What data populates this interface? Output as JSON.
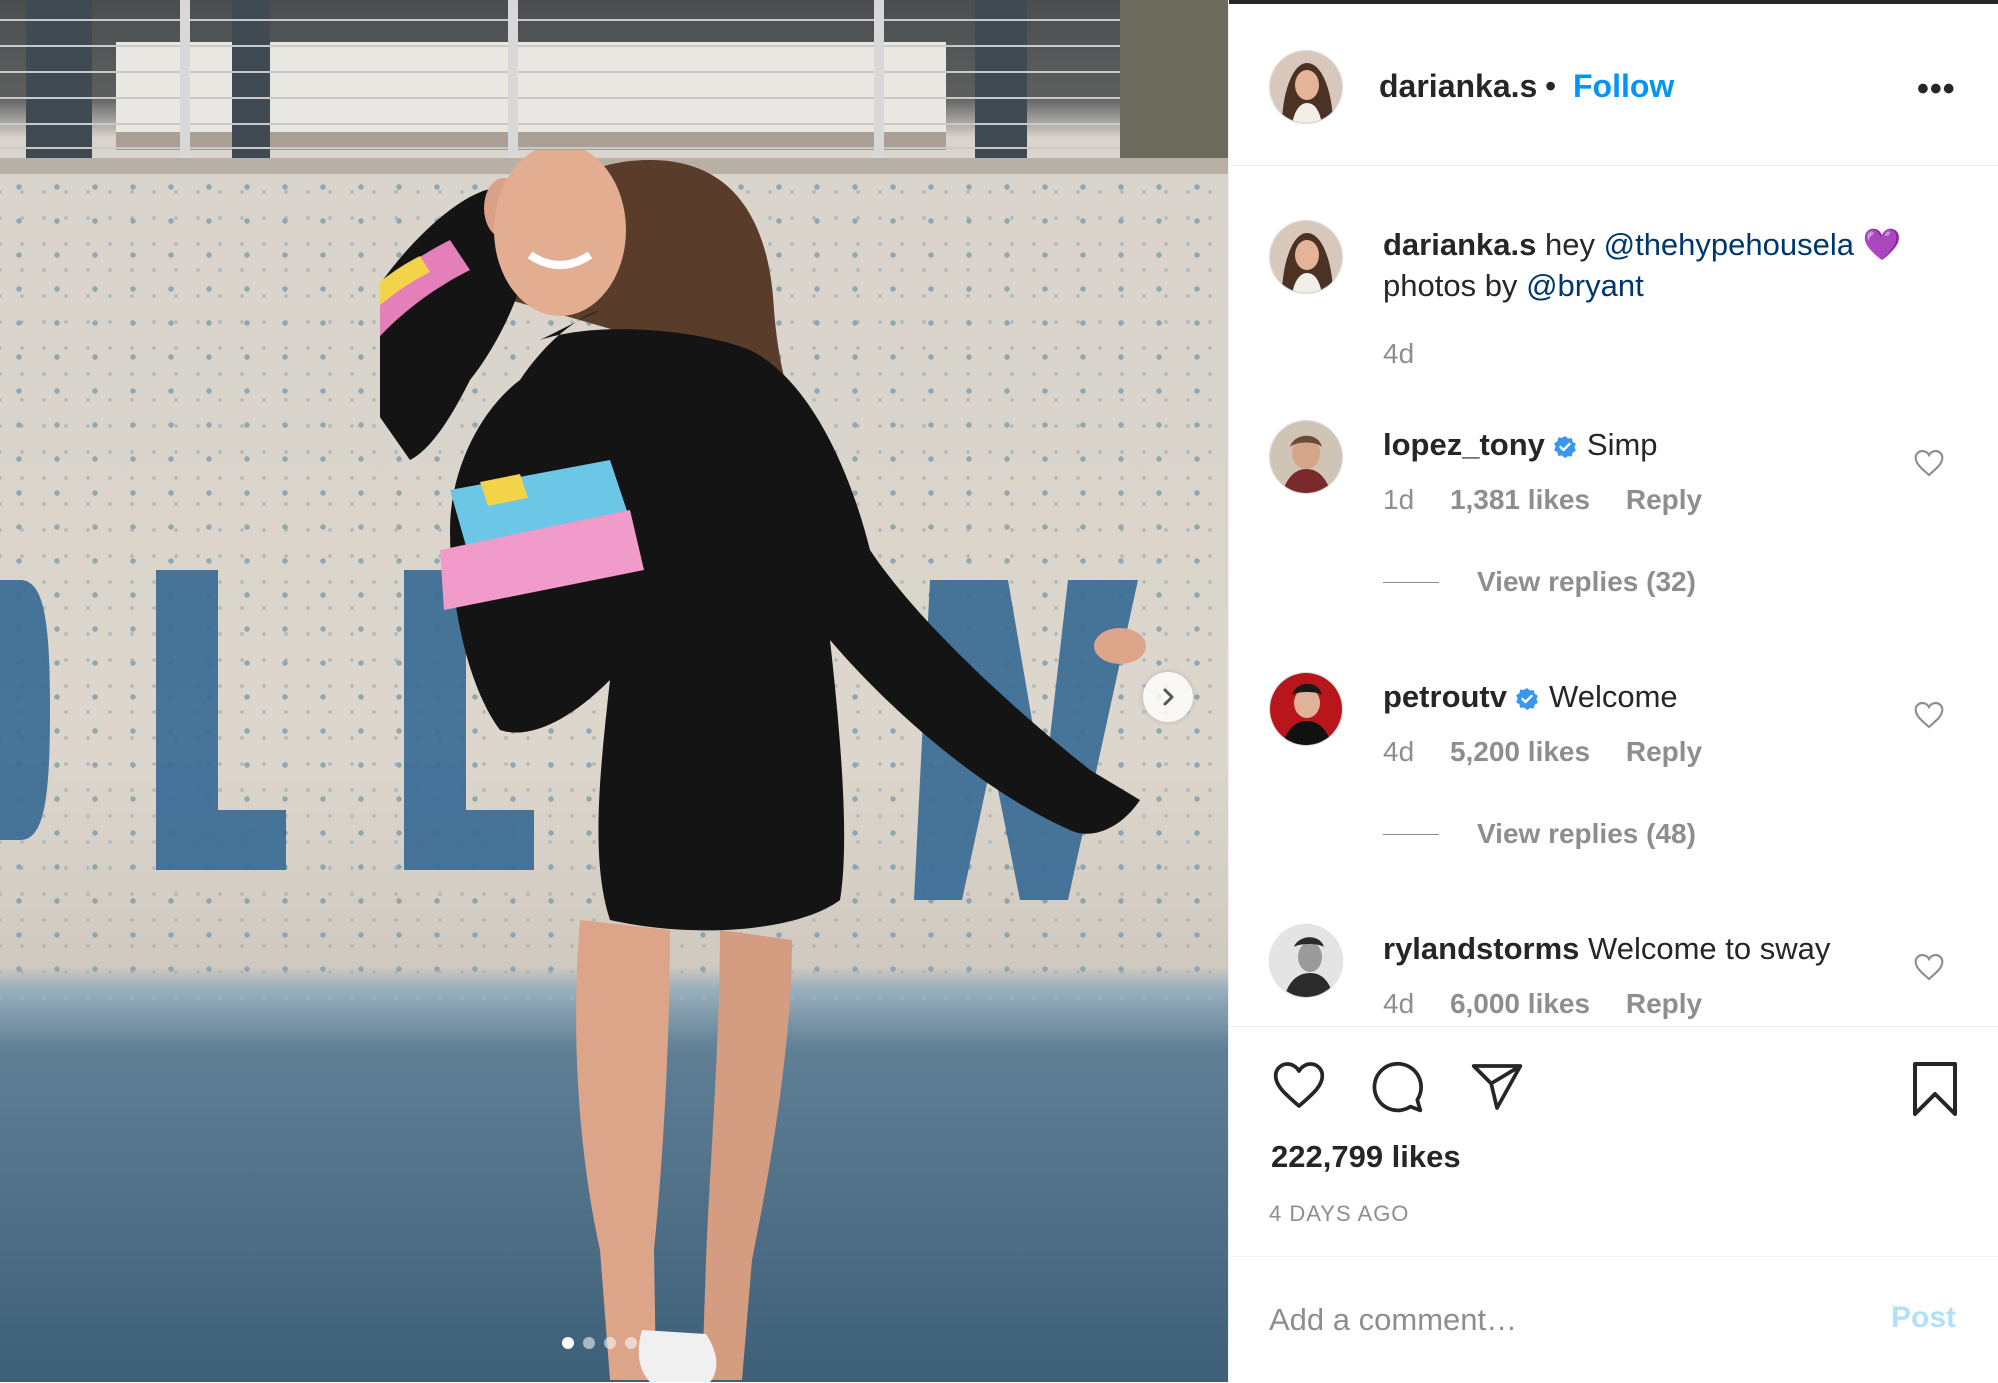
{
  "post": {
    "username": "darianka.s",
    "separator": "•",
    "follow_label": "Follow",
    "more_label": "•••",
    "carousel": {
      "slide_count": 4,
      "active_index": 0
    }
  },
  "caption": {
    "username": "darianka.s",
    "text_prefix": "hey",
    "mention1": "@thehypehousela",
    "emoji": "💜",
    "text_line2_prefix": "photos by",
    "mention2": "@bryant",
    "time": "4d"
  },
  "comments": [
    {
      "username": "lopez_tony",
      "verified": true,
      "text": "Simp",
      "time": "1d",
      "likes": "1,381 likes",
      "reply_label": "Reply",
      "replies": "View replies (32)"
    },
    {
      "username": "petroutv",
      "verified": true,
      "text": "Welcome",
      "time": "4d",
      "likes": "5,200 likes",
      "reply_label": "Reply",
      "replies": "View replies (48)"
    },
    {
      "username": "rylandstorms",
      "verified": false,
      "text": "Welcome to sway",
      "time": "4d",
      "likes": "6,000 likes",
      "reply_label": "Reply"
    }
  ],
  "stats": {
    "likes": "222,799 likes",
    "posted_ago": "4 DAYS AGO"
  },
  "comment_box": {
    "placeholder": "Add a comment…",
    "post_label": "Post"
  },
  "colors": {
    "link_blue": "#0095f6",
    "mention_navy": "#00376b",
    "muted": "#8e8e8e",
    "post_disabled": "#b2dffc"
  },
  "icons": [
    "chevron-right-icon",
    "more-icon",
    "verified-icon",
    "heart-icon",
    "comment-icon",
    "share-icon",
    "bookmark-icon"
  ]
}
